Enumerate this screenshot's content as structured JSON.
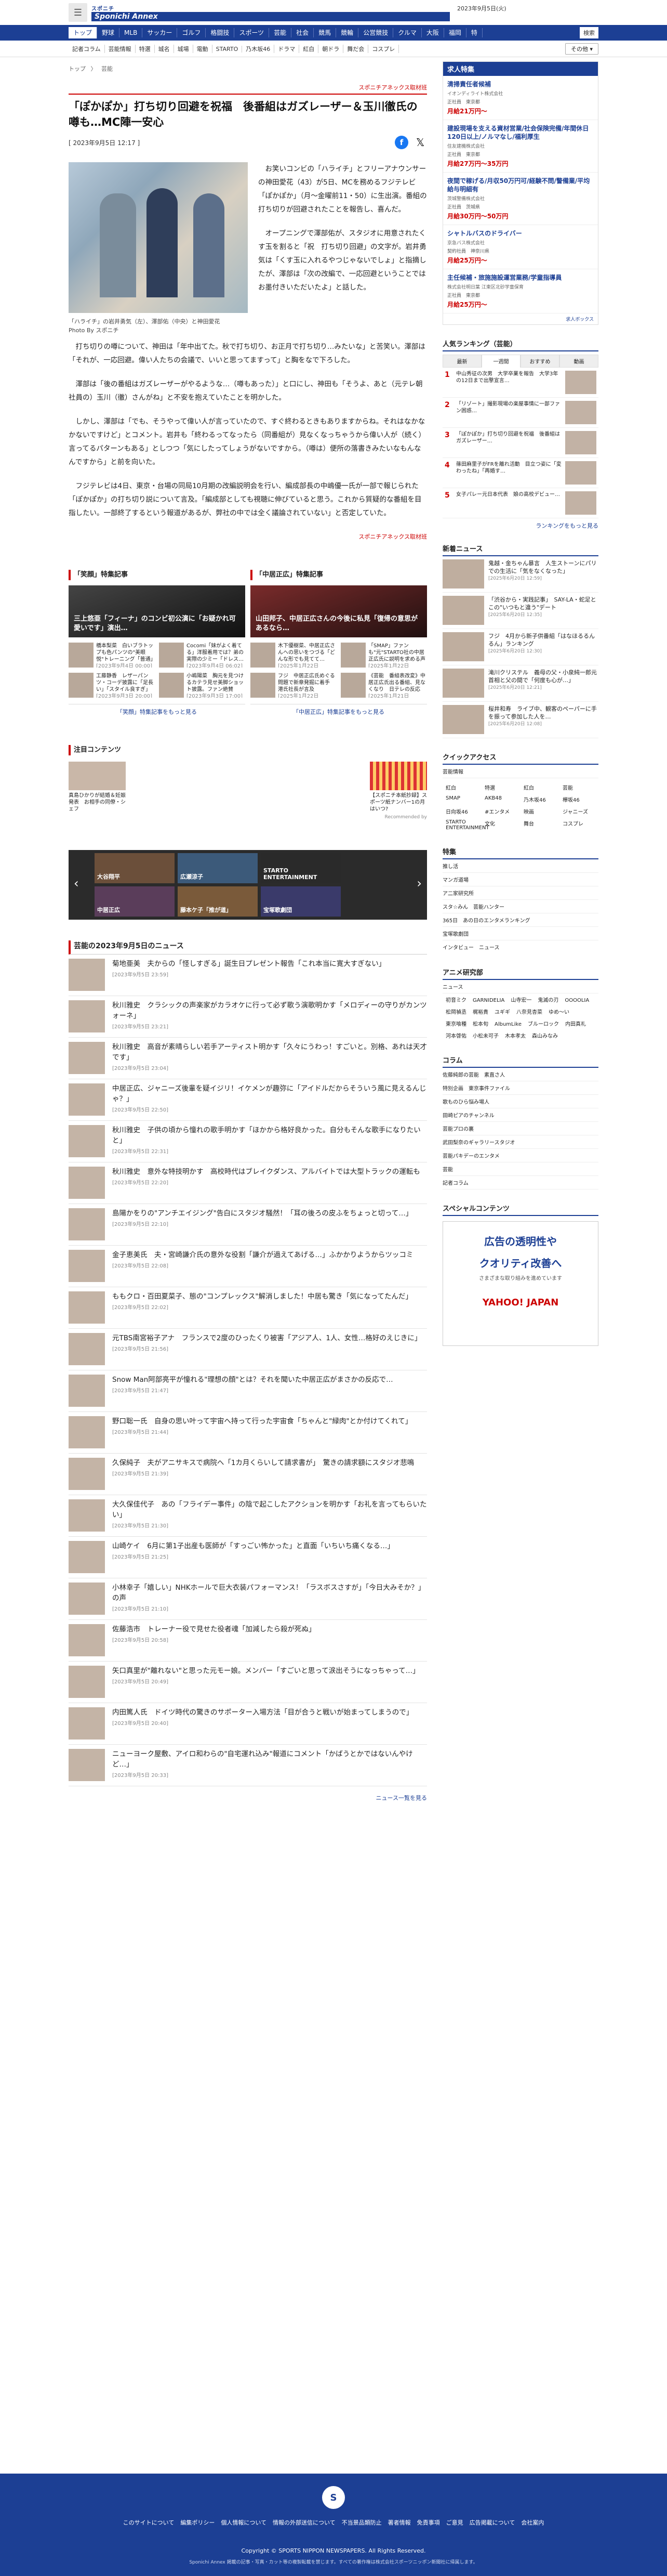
{
  "header": {
    "logo_top": "スポニチ",
    "logo_main": "Sponichi Annex",
    "date": "2023年9月5日(火)"
  },
  "nav": [
    "トップ",
    "野球",
    "MLB",
    "サッカー",
    "ゴルフ",
    "格闘技",
    "スポーツ",
    "芸能",
    "社会",
    "競馬",
    "競輪",
    "公営競技",
    "クルマ",
    "大阪",
    "福岡",
    "特"
  ],
  "nav_search": "検索",
  "subnav": [
    "記者コラム",
    "芸能情報",
    "特選",
    "城名",
    "城場",
    "電動",
    "STARTO",
    "乃木坂46",
    "ドラマ",
    "紅白",
    "朝ドラ",
    "舞だ会",
    "コスプレ"
  ],
  "subnav_more": "その他 ▾",
  "breadcrumb": [
    "トップ",
    "〉",
    "芸能"
  ],
  "source_tag": "スポニチアネックス取材班",
  "article": {
    "title": "「ぽかぽか」打ち切り回避を祝福　後番組はガズレーザー＆玉川徹氏の噂も…MC陣一安心",
    "datetime": "[ 2023年9月5日 12:17 ]",
    "caption": "「ハライチ」の岩井勇気（左）、澤部佑（中央）と神田愛花",
    "photo_credit": "Photo By スポニチ",
    "p1": "お笑いコンビの「ハライチ」とフリーアナウンサーの神田愛花（43）が5日、MCを務めるフジテレビ「ぽかぽか」（月～金曜前11・50）に生出演。番組の打ち切りが回避されたことを報告し、喜んだ。",
    "p2": "オープニングで澤部佑が、スタジオに用意されたくす玉を割ると「祝　打ち切り回避」の文字が。岩井勇気は「くす玉に入れるやつじゃないでしょ」と指摘したが、澤部は「次の改編で、一応回避ということではお墨付きいただいたよ」と話した。",
    "p3": "打ち切りの噂について、神田は「年中出てた。秋で打ち切り、お正月で打ち切り…みたいな」と苦笑い。澤部は「それが、一応回避。偉い人たちの会議で、いいと思ってますって」と胸をなで下ろした。",
    "p4": "澤部は「後の番組はガズレーザーがやるような…（噂もあった）」と口にし、神田も「そうよ、あと（元テレ朝社員の）玉川（徹）さんがね」と不安を抱えていたことを明かした。",
    "p5": "しかし、澤部は「でも、そうやって偉い人が言っていたので、すぐ終わるときもありますからね。それはなかなかないですけど」とコメント。岩井も「終わるってなったら（同番組が）見なくなっちゃうから偉い人が（続く）言ってるパターンもある」としつつ「気にしたってしょうがないですから。（噂は）便所の落書きみたいなもんなんですから」と前を向いた。",
    "p6": "フジテレビは4日、東京・台場の同局10月期の改編説明会を行い、編成部長の中嶋優一氏が一部で報じられた「ぽかぽか」の打ち切り説について言及。「編成部としても視聴に伸びていると思う。これから質疑的な番組を目指したい。一部終了するという報道があるが、弊社の中では全く議論されていない」と否定していた。",
    "src": "スポニチアネックス取材班"
  },
  "box_left": {
    "title": "「笑顔」特集記事",
    "hero": "三上悠亜「フィーナ」のコンビ初公演に「お疑かれ可愛いです」演出…",
    "items": [
      {
        "t": "橋本梨菜　白いブラトップも色パンツの\"美眼悦\"トレーニング「普通」",
        "d": "[2023年9月4日 00:00]"
      },
      {
        "t": "Cocomi「妹がよく着てる」洋服着用では？弟の実際の少ミー「ドレス…",
        "d": "[2023年9月4日 06:02]"
      },
      {
        "t": "工藤静香　レザーパンツ・コーデ披露に「足長い」「スタイル良すぎ」",
        "d": "[2023年9月3日 20:00]"
      },
      {
        "t": "小嶋陽菜　胸元を見つけるカテラ見せ美脚ショット披露。ファン絶賛",
        "d": "[2023年9月3日 17:00]"
      }
    ],
    "more": "「笑顔」特集記事をもっと見る"
  },
  "box_right": {
    "title": "「中居正広」特集記事",
    "hero": "山田邦子、中居正広さんの今後に私見「復帰の意思があるなら…",
    "items": [
      {
        "t": "木下優樹菜、中居正広さんへの思いをつづる「どんな形でも見てて…",
        "d": "[2025年1月22日 14:00]"
      },
      {
        "t": "「SMAP」ファンも\"元\"STARTO社の中居正広氏に説明を求める声",
        "d": "[2025年1月22日 12:00]"
      },
      {
        "t": "フジ　中居正広氏めぐる問題で新章発掘に着手　港氏社長が言及",
        "d": "[2025年1月22日 08:00]"
      },
      {
        "t": "《芸能　番組表改変》中居正広氏出る番組、見なくなり　日テレの反応",
        "d": "[2025年1月21日 18:00]"
      }
    ],
    "more": "「中居正広」特集記事をもっと見る"
  },
  "notice": {
    "title": "注目コンテンツ",
    "cards": [
      {
        "t": "真島ひかりが結婚＆妊娠発表　お相手の同僚・シェフ"
      },
      {
        "t": "【スポニチ本紙抄録】スポーツ紙ナンバー1の月はいつ?"
      }
    ],
    "sponsor": "Recommended by"
  },
  "carousel": [
    "大谷翔平",
    "広瀬涼子",
    "STARTO ENTERTAINMENT",
    "中居正広",
    "藤本ケ子「推が道」",
    "宝塚歌劇団"
  ],
  "news_list": {
    "title": "芸能の2023年9月5日のニュース",
    "items": [
      {
        "t": "菊地亜美　夫からの「怪しすぎる」誕生日プレゼント報告「これ本当に寛大すぎない」",
        "d": "[2023年9月5日 23:59]"
      },
      {
        "t": "秋川雅史　クラシックの声楽家がカラオケに行って必ず歌う演歌明かす「メロディーの守りがカンツォーネ」",
        "d": "[2023年9月5日 23:21]"
      },
      {
        "t": "秋川雅史　高音が素晴らしい若手アーティスト明かす「久々にうわっ！すごいと。別格、あれは天才です」",
        "d": "[2023年9月5日 23:04]"
      },
      {
        "t": "中居正広、ジャニーズ後輩を疑イジリ！イケメンが趣弥に「アイドルだからそういう風に見えるんじゃ？」",
        "d": "[2023年9月5日 22:50]"
      },
      {
        "t": "秋川雅史　子供の頃から憧れの歌手明かす「ほかから格好良かった。自分もそんな歌手になりたいと」",
        "d": "[2023年9月5日 22:31]"
      },
      {
        "t": "秋川雅史　意外な特技明かす　高校時代はブレイクダンス、アルバイトでは大型トラックの運転も",
        "d": "[2023年9月5日 22:20]"
      },
      {
        "t": "島陽かをりの\"アンチエイジング\"告白にスタジオ騒然！「耳の後ろの皮ふをちょっと切って…」",
        "d": "[2023年9月5日 22:10]"
      },
      {
        "t": "金子恵美氏　夫・宮崎謙介氏の意外な役割「謙介が過えてあげる…」ふかかりようからツッコミ",
        "d": "[2023年9月5日 22:08]"
      },
      {
        "t": "ももクロ・百田夏菜子、態の\"コンプレックス\"解消しました！中居も驚き「気になってたんだ」",
        "d": "[2023年9月5日 22:02]"
      },
      {
        "t": "元TBS南宮裕子アナ　フランスで2度のひったくり被害「アジア人、1人、女性…格好のえじきに」",
        "d": "[2023年9月5日 21:56]"
      },
      {
        "t": "Snow Man阿部亮平が憧れる\"理想の顔\"とは？それを聞いた中居正広がまさかの反応で…",
        "d": "[2023年9月5日 21:47]"
      },
      {
        "t": "野口聡一氏　自身の思い叶って宇宙へ持って行った宇宙食「ちゃんと\"緑肉\"とか付けてくれて」",
        "d": "[2023年9月5日 21:44]"
      },
      {
        "t": "久保純子　夫がアニサキスで病院へ「1カ月くらいして請求書が」　驚きの請求額にスタジオ悲鳴",
        "d": "[2023年9月5日 21:39]"
      },
      {
        "t": "大久保佳代子　あの「フライデー事件」の陰で起こしたアクションを明かす「お礼を言ってもらいたい」",
        "d": "[2023年9月5日 21:30]"
      },
      {
        "t": "山崎ケイ　6月に第1子出産も医師が「すっごい怖かった」と直面「いちいち痛くなる…」",
        "d": "[2023年9月5日 21:25]"
      },
      {
        "t": "小林幸子「嬉しい」NHKホールで巨大衣装パフォーマンス！「ラスボスさすが」「今日大みそか？」の声",
        "d": "[2023年9月5日 21:10]"
      },
      {
        "t": "佐藤浩市　トレーナー役で見せた役者魂「加減したら殺が死ぬ」",
        "d": "[2023年9月5日 20:58]"
      },
      {
        "t": "矢口真里が\"離れない\"と思った元モー娘。メンバー「すごいと思って涙出そうになっちゃって…」",
        "d": "[2023年9月5日 20:49]"
      },
      {
        "t": "内田篤人氏　ドイツ時代の驚きのサポーター入場方法「目が合うと戦いが始まってしまうので」",
        "d": "[2023年9月5日 20:40]"
      },
      {
        "t": "ニューヨーク屋敷、アイロ和わらの\"自宅運れ込み\"報道にコメント「かばうとかではないんやけど…」",
        "d": "[2023年9月5日 20:33]"
      }
    ],
    "all": "ニュース一覧を見る"
  },
  "side": {
    "jobs_title": "求人特集",
    "jobs": [
      {
        "t": "清掃責任者候補",
        "c": "イオンディライト株式会社",
        "tag": "正社員　東京都",
        "sal": "月給21万円～"
      },
      {
        "t": "建設現場を支える資材営業/社会保険完備/年間休日120日以上/ノルマなし/福利厚生",
        "c": "住友建機株式会社",
        "tag": "正社員　東京都",
        "sal": "月給27万円～35万円"
      },
      {
        "t": "夜間で稼げる/月収50万円可/経験不問/警備業/平均給与明細有",
        "c": "茨城警備株式会社",
        "tag": "正社員　茨城県",
        "sal": "月給30万円～50万円"
      },
      {
        "t": "シャトルバスのドライバー",
        "c": "京急バス株式会社",
        "tag": "契約社員　神奈川県",
        "sal": "月給25万円～"
      },
      {
        "t": "主任候補・旅施施設運営業務/学童指導員",
        "c": "株式会社明日葉 江東区北砂学童保育",
        "tag": "正社員　東京都",
        "sal": "月給25万円～"
      }
    ],
    "jobs_foot": "求人ボックス",
    "ranking_title": "人気ランキング（芸能）",
    "ranking_tabs": [
      "最新",
      "一週間",
      "おすすめ",
      "動画"
    ],
    "ranking": [
      {
        "n": "1",
        "t": "中山秀征の次男　大学卒業を報告　大学3年の12日まで出撃宣言…"
      },
      {
        "n": "2",
        "t": "「リゾート」撮影現場の楽屋事情に一部ファン困惑…"
      },
      {
        "n": "3",
        "t": "「ぽかぽか」打ち切り回避を祝福　後番組はガズレーザー…"
      },
      {
        "n": "4",
        "t": "篠田麻里子がFRを離れ活動　目立つ姿に「変わったね」「再婚す…"
      },
      {
        "n": "5",
        "t": "女子パレー元日本代表　娘の高校デビュー…"
      }
    ],
    "ranking_more": "ランキングをもっと見る",
    "news_title": "新着ニュース",
    "news": [
      {
        "t": "鬼越・金ちゃん暴言　人生ストーンにパリでの生活に「気をなくなった」",
        "d": "[2025年6月20日 12:59]"
      },
      {
        "t": "「渋谷から・実践記事」　SAY-LA・蛇足とこの\"いつもと違う\"デート",
        "d": "[2025年6月20日 12:35]"
      },
      {
        "t": "フジ　4月から新子供番組「はなほるるんるん」ランキング",
        "d": "[2025年6月20日 12:30]"
      },
      {
        "t": "滝川クリステル　義母の父・小泉純一郎元首相と父の間で「何度も心が…」",
        "d": "[2025年6月20日 12:21]"
      },
      {
        "t": "桜井和寿　ライブ中、観客のペーパーに手を振って参加した人を…",
        "d": "[2025年6月20日 12:08]"
      }
    ],
    "quick_title": "クイックアクセス",
    "quick_sub": "芸能情報",
    "quick": [
      "紅白",
      "特選",
      "紅白",
      "芸能",
      "SMAP",
      "AKB48",
      "乃木坂46",
      "欅坂46",
      "日向坂46",
      "#エンタメ",
      "映画",
      "ジャニーズ",
      "STARTO ENTERTAINMENT",
      "文化",
      "舞台",
      "コスプレ"
    ],
    "feature_title": "特集",
    "features": [
      "推し活",
      "マンガ道場",
      "ア二家研究所",
      "スタ☆みん　芸能ハンター",
      "365日　あの日のエンタメランキング",
      "宝塚歌劇団"
    ],
    "feature_sub": "インタビュー　ニュース",
    "anime_title": "アニメ研究部",
    "anime_sub": "ニュース",
    "anime_tags": [
      "初音ミク",
      "GARNIDELIA",
      "山寺宏一",
      "鬼滅の刃",
      "OOOOLIA",
      "松岡禎丞",
      "梶裕貴",
      "ユギギ",
      "八奈見杏菜",
      "ゆめ～い",
      "東京喰種",
      "松本旬",
      "AlbumLike",
      "ブルーロック",
      "内田真礼",
      "河本啓佑",
      "小松未可子",
      "木本孝太",
      "森山みなみ"
    ],
    "column_title": "コラム",
    "columns": [
      "佐藤純郎の芸能　素直さ人",
      "特別企画　東京事件ファイル",
      "歌ものひら悩み場人",
      "田崎ピアのチャンネル",
      "芸能プロの裏",
      "武田梨奈のギャラリースタジオ",
      "芸能パキデーのエンタメ",
      "芸能",
      "記者コラム"
    ],
    "special_title": "スペシャルコンテンツ",
    "ad_line1": "広告の透明性や",
    "ad_line2": "クオリティ改善へ",
    "ad_small": "さまざまな取り組みを進めています",
    "ad_brand": "YAHOO! JAPAN"
  },
  "footer": {
    "logo": "S",
    "links": [
      "このサイトについて",
      "編集ポリシー",
      "個人情報について",
      "情報の外部送信について",
      "不当景品類防止",
      "著者情報",
      "免責事項",
      "ご意見",
      "広告掲載について",
      "会社案内"
    ],
    "copy": "Copyright © SPORTS NIPPON NEWSPAPERS. All Rights Reserved.",
    "note": "Sponichi Annex 掲載の記事・写真・カット等の複製転載を禁じます。すべての著作権は株式会社スポーツニッポン新聞社に帰属します。"
  }
}
